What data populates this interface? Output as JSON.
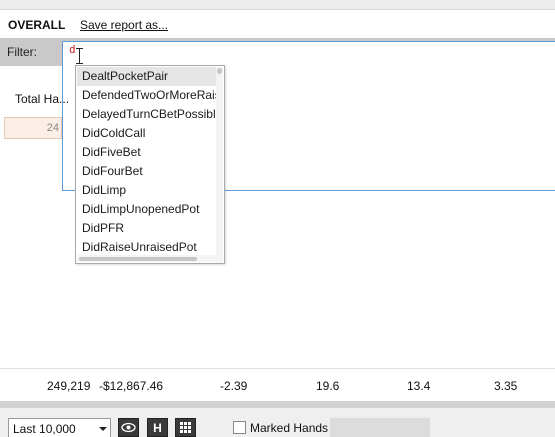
{
  "header": {
    "title": "OVERALL",
    "save_link": "Save report as..."
  },
  "filter": {
    "label": "Filter:",
    "typed_value": "d"
  },
  "autocomplete": {
    "items": [
      "DealtPocketPair",
      "DefendedTwoOrMoreRaises",
      "DelayedTurnCBetPossible",
      "DidColdCall",
      "DidFiveBet",
      "DidFourBet",
      "DidLimp",
      "DidLimpUnopenedPot",
      "DidPFR",
      "DidRaiseUnraisedPot"
    ],
    "selected_index": 0
  },
  "stats": {
    "column_header": "Total Ha...",
    "first_cell": "24"
  },
  "totals": [
    "249,219",
    "-$12,867.46",
    "-2.39",
    "19.6",
    "13.4",
    "3.35"
  ],
  "bottom_bar": {
    "range_value": "Last 10,000",
    "h_button": "H",
    "marked_hands_label": "Marked Hands"
  }
}
